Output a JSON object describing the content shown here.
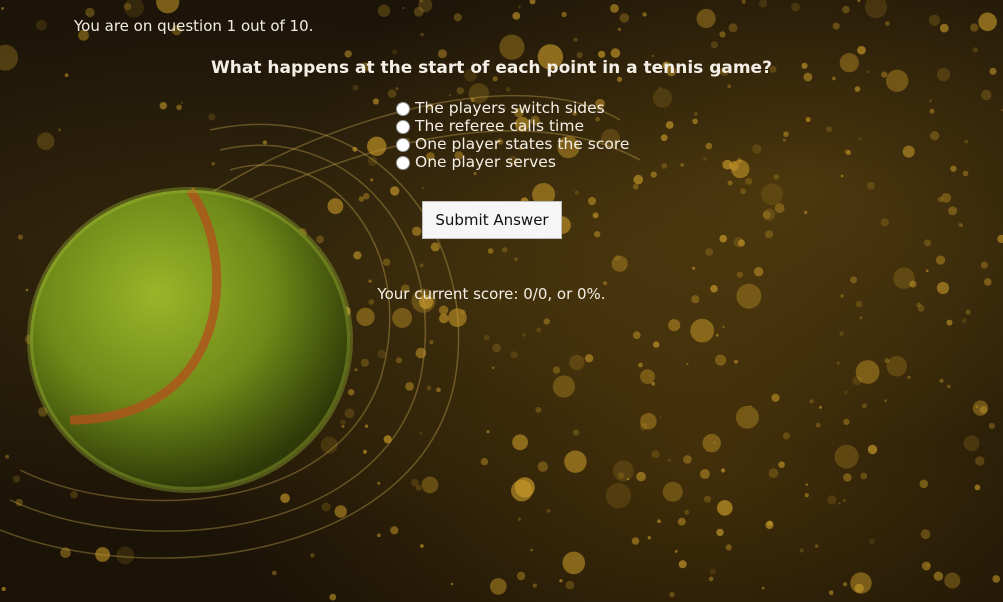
{
  "progress": {
    "text": "You are on question 1 out of 10."
  },
  "question": {
    "text": "What happens at the start of each point in a tennis game?"
  },
  "answers": [
    {
      "label": "The players switch sides"
    },
    {
      "label": "The referee calls time"
    },
    {
      "label": "One player states the score"
    },
    {
      "label": "One player serves"
    }
  ],
  "submit": {
    "label": "Submit Answer"
  },
  "score": {
    "text": "Your current score: 0/0, or 0%."
  },
  "background": {
    "icon": "tennis-ball-bokeh-image",
    "ball_color": "#7a9a1c",
    "bokeh_color": "#c89a2a"
  }
}
